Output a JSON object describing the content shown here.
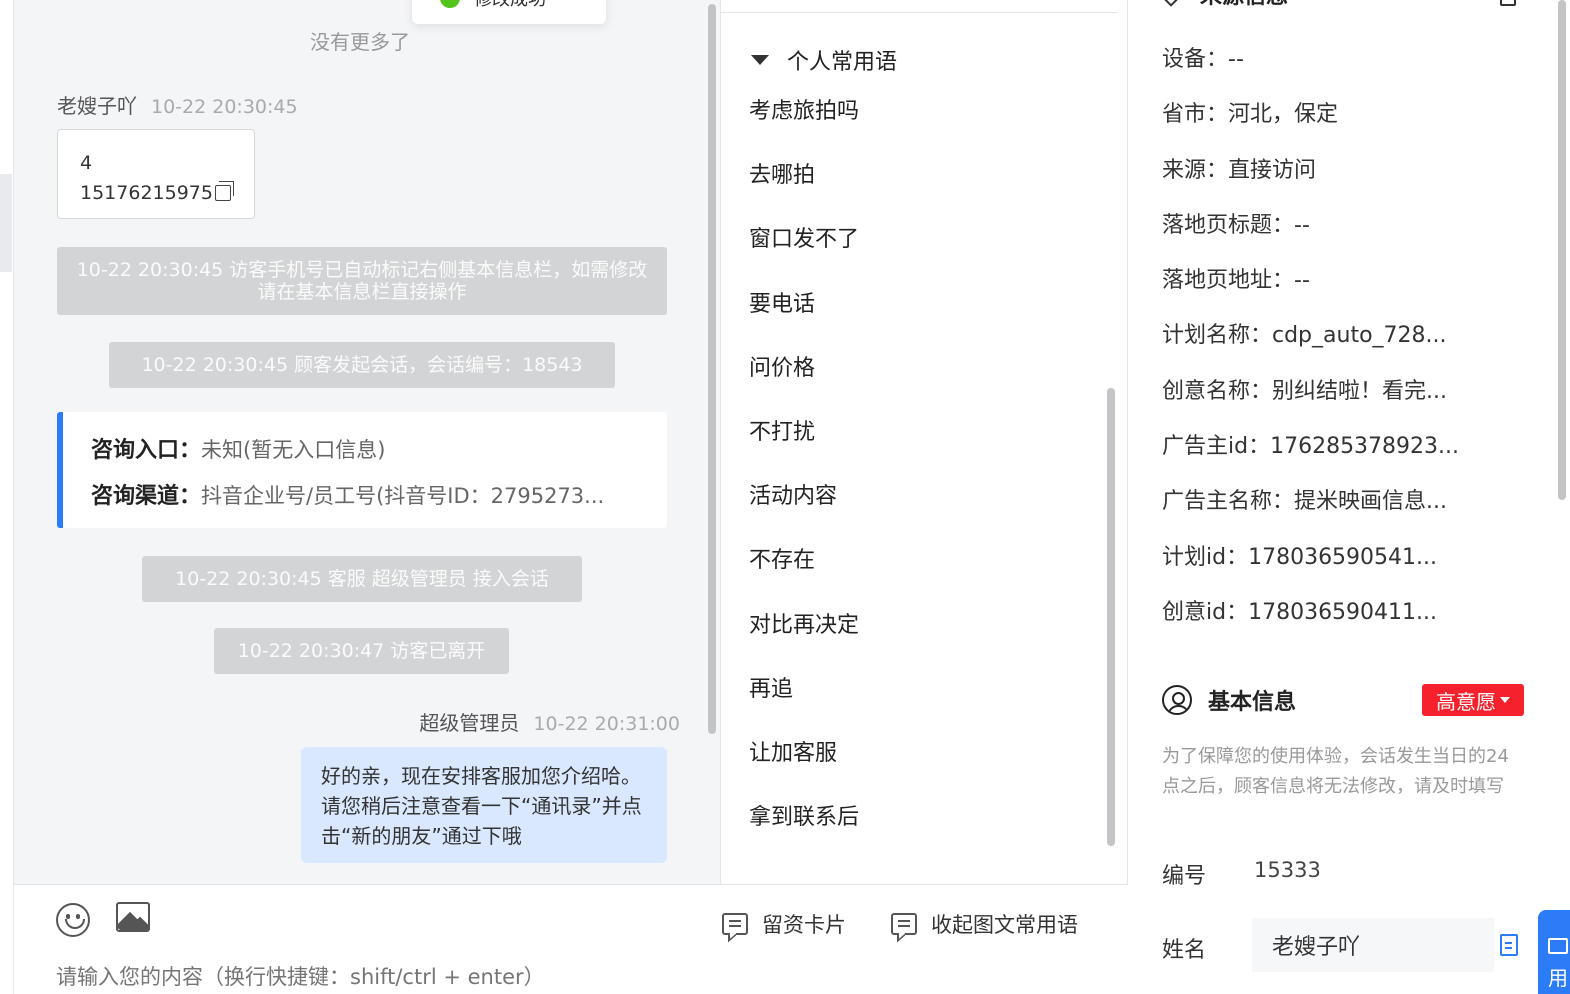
{
  "toast": {
    "text": "修改成功"
  },
  "chat": {
    "no_more": "没有更多了",
    "visitor": {
      "name": "老嫂子吖",
      "time": "10-22 20:30:45"
    },
    "phone_card": {
      "line1": "4",
      "line2": "15176215975"
    },
    "system_messages": [
      "10-22 20:30:45 访客手机号已自动标记右侧基本信息栏，如需修改请在基本信息栏直接操作",
      "10-22 20:30:45 顾客发起会话，会话编号：18543",
      "10-22 20:30:45 客服 超级管理员 接入会话",
      "10-22 20:30:47 访客已离开"
    ],
    "entry_card": {
      "entry_label": "咨询入口：",
      "entry_value": "未知(暂无入口信息)",
      "channel_label": "咨询渠道：",
      "channel_value": "抖音企业号/员工号(抖音号ID：2795273..."
    },
    "agent": {
      "name": "超级管理员",
      "time": "10-22 20:31:00"
    },
    "agent_message": "好的亲，现在安排客服加您介绍哈。请您稍后注意查看一下“通讯录”并点击“新的朋友”通过下哦"
  },
  "composer": {
    "card_label": "留资卡片",
    "collapse_label": "收起图文常用语",
    "placeholder": "请输入您的内容（换行快捷键：shift/ctrl + enter）"
  },
  "phrases": {
    "group_title": "个人常用语",
    "items": [
      "考虑旅拍吗",
      "去哪拍",
      "窗口发不了",
      "要电话",
      "问价格",
      "不打扰",
      "活动内容",
      "不存在",
      "对比再决定",
      "再追",
      "让加客服",
      "拿到联系后"
    ]
  },
  "info": {
    "source_title": "来源信息",
    "source_items": [
      "设备：--",
      "省市：河北，保定",
      "来源：直接访问",
      "落地页标题：--",
      "落地页地址：--",
      "计划名称：cdp_auto_728...",
      "创意名称：别纠结啦！看完...",
      "广告主id：176285378923...",
      "广告主名称：提米映画信息...",
      "计划id：178036590541...",
      "创意id：178036590411..."
    ],
    "basic_title": "基本信息",
    "intent_badge": "高意愿",
    "notice": "为了保障您的使用体验，会话发生当日的24点之后，顾客信息将无法修改，请及时填写",
    "id_label": "编号",
    "id_value": "15333",
    "name_label": "姓名",
    "name_value": "老嫂子吖",
    "float_label": "用"
  }
}
